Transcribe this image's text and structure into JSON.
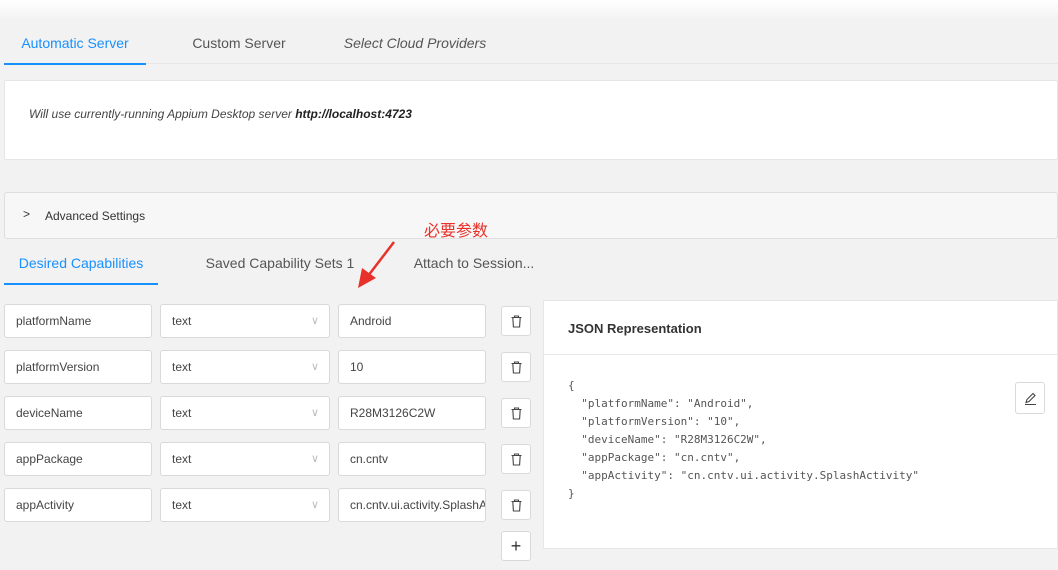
{
  "server_tabs": [
    {
      "label": "Automatic Server",
      "active": true
    },
    {
      "label": "Custom Server",
      "active": false
    },
    {
      "label": "Select Cloud Providers",
      "active": false
    }
  ],
  "server_panel": {
    "text": "Will use currently-running Appium Desktop server ",
    "url": "http://localhost:4723"
  },
  "advanced": {
    "label": "Advanced Settings",
    "chevron_icon": "chevron-right-icon"
  },
  "annotation": {
    "text": "必要参数",
    "color": "#e8312a"
  },
  "capability_tabs": [
    {
      "label": "Desired Capabilities",
      "active": true
    },
    {
      "label": "Saved Capability Sets 1",
      "active": false
    },
    {
      "label": "Attach to Session...",
      "active": false
    }
  ],
  "capabilities": [
    {
      "name": "platformName",
      "type": "text",
      "value": "Android"
    },
    {
      "name": "platformVersion",
      "type": "text",
      "value": "10"
    },
    {
      "name": "deviceName",
      "type": "text",
      "value": "R28M3126C2W"
    },
    {
      "name": "appPackage",
      "type": "text",
      "value": "cn.cntv"
    },
    {
      "name": "appActivity",
      "type": "text",
      "value": "cn.cntv.ui.activity.SplashActivity"
    }
  ],
  "add_button": "+",
  "json_panel": {
    "title": "JSON Representation",
    "body": "{\n  \"platformName\": \"Android\",\n  \"platformVersion\": \"10\",\n  \"deviceName\": \"R28M3126C2W\",\n  \"appPackage\": \"cn.cntv\",\n  \"appActivity\": \"cn.cntv.ui.activity.SplashActivity\"\n}"
  },
  "colors": {
    "accent": "#1890ff",
    "annotation": "#e8312a",
    "background": "#f2f2f2"
  }
}
